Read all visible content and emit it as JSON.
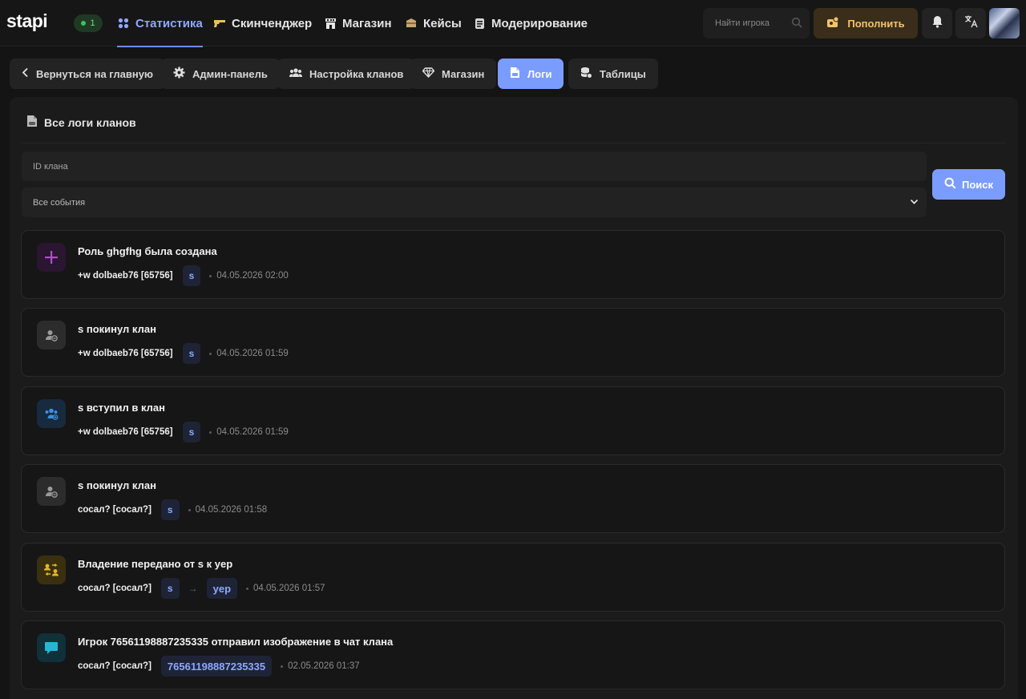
{
  "header": {
    "logo": "stapi",
    "online_count": "1",
    "nav": [
      {
        "label": "Статистика",
        "icon": "grid-dots-icon",
        "active": true
      },
      {
        "label": "Скинченджер",
        "icon": "gun-icon"
      },
      {
        "label": "Магазин",
        "icon": "shop-icon"
      },
      {
        "label": "Кейсы",
        "icon": "case-icon"
      },
      {
        "label": "Модерирование",
        "icon": "document-icon"
      }
    ],
    "search_placeholder": "Найти игрока",
    "topup_label": "Пополнить",
    "accent_color": "#7b9cff",
    "gold_color": "#f2c46b"
  },
  "subnav": [
    {
      "label": "Вернуться на главную",
      "icon": "chevron-left-icon"
    },
    {
      "label": "Админ-панель",
      "icon": "gear-icon"
    },
    {
      "label": "Настройка кланов",
      "icon": "users-icon"
    },
    {
      "label": "Магазин",
      "icon": "diamond-icon"
    },
    {
      "label": "Логи",
      "icon": "log-file-icon",
      "active": true
    },
    {
      "label": "Таблицы",
      "icon": "database-icon"
    }
  ],
  "panel": {
    "title": "Все логи кланов",
    "clan_id_placeholder": "ID клана",
    "event_filter_value": "Все события",
    "search_button": "Поиск"
  },
  "logs": [
    {
      "title": "Роль ghgfhg была создана",
      "icon": "plus-icon",
      "actor": "+w dolbaeb76 [65756]",
      "tags": [
        "s"
      ],
      "time": "04.05.2026 02:00"
    },
    {
      "title": "s покинул клан",
      "icon": "user-leave-icon",
      "actor": "+w dolbaeb76 [65756]",
      "tags": [
        "s"
      ],
      "time": "04.05.2026 01:59"
    },
    {
      "title": "s вступил в клан",
      "icon": "user-join-icon",
      "actor": "+w dolbaeb76 [65756]",
      "tags": [
        "s"
      ],
      "time": "04.05.2026 01:59"
    },
    {
      "title": "s покинул клан",
      "icon": "user-leave-icon",
      "actor": "сосал? [сосал?]",
      "tags": [
        "s"
      ],
      "time": "04.05.2026 01:58"
    },
    {
      "title": "Владение передано от s к yep",
      "icon": "ownership-transfer-icon",
      "actor": "сосал? [сосал?]",
      "tags": [
        "s",
        "yep"
      ],
      "arrow": "→",
      "time": "04.05.2026 01:57"
    },
    {
      "title": "Игрок 76561198887235335 отправил изображение в чат клана",
      "icon": "chat-bubble-icon",
      "actor": "сосал? [сосал?]",
      "tags": [
        "76561198887235335"
      ],
      "time": "02.05.2026 01:37"
    }
  ]
}
